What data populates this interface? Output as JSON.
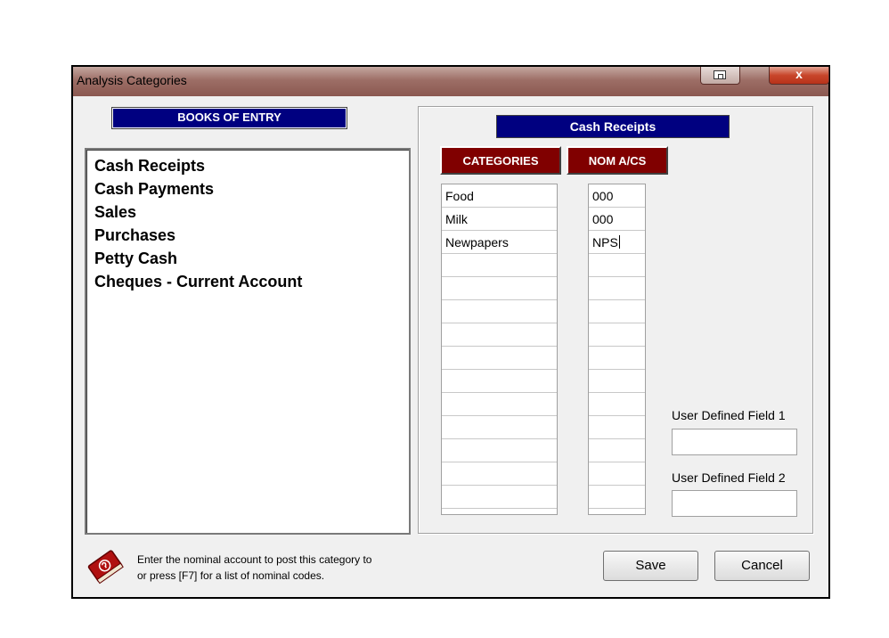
{
  "window": {
    "title": "Analysis Categories",
    "close_glyph": "x"
  },
  "books": {
    "header": "BOOKS OF ENTRY",
    "items": [
      "Cash Receipts",
      "Cash Payments",
      "Sales",
      "Purchases",
      "Petty Cash",
      "Cheques - Current Account"
    ]
  },
  "detail": {
    "banner": "Cash Receipts",
    "categories_header": "CATEGORIES",
    "nom_header": "NOM A/CS",
    "rows": [
      {
        "category": "Food",
        "nom": "000"
      },
      {
        "category": "Milk",
        "nom": "000"
      },
      {
        "category": "Newpapers",
        "nom": "NPS"
      },
      {
        "category": "",
        "nom": ""
      },
      {
        "category": "",
        "nom": ""
      },
      {
        "category": "",
        "nom": ""
      },
      {
        "category": "",
        "nom": ""
      },
      {
        "category": "",
        "nom": ""
      },
      {
        "category": "",
        "nom": ""
      },
      {
        "category": "",
        "nom": ""
      },
      {
        "category": "",
        "nom": ""
      },
      {
        "category": "",
        "nom": ""
      },
      {
        "category": "",
        "nom": ""
      },
      {
        "category": "",
        "nom": ""
      }
    ],
    "user_field_1": {
      "label": "User Defined Field 1",
      "value": ""
    },
    "user_field_2": {
      "label": "User Defined Field 2",
      "value": ""
    }
  },
  "footer": {
    "help_line_1": "Enter the nominal account to post this category to",
    "help_line_2": "or press [F7] for a list of nominal codes.",
    "save_label": "Save",
    "cancel_label": "Cancel"
  },
  "icons": {
    "help": "help-book-icon"
  },
  "colors": {
    "banner_navy": "#000080",
    "header_maroon": "#800000",
    "titlebar": "#9d6e66"
  }
}
